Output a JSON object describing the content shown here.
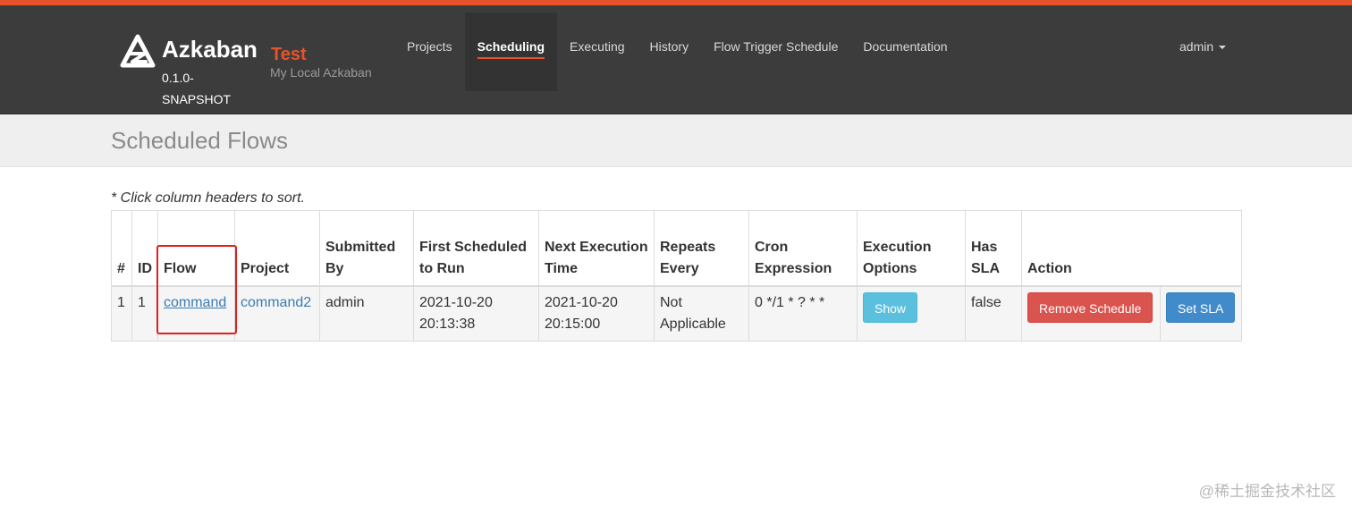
{
  "brand": {
    "name": "Azkaban",
    "version": "0.1.0-SNAPSHOT",
    "env_name": "Test",
    "env_description": "My Local Azkaban",
    "accent_color": "#e8532a"
  },
  "nav": {
    "items": [
      {
        "label": "Projects",
        "active": false
      },
      {
        "label": "Scheduling",
        "active": true
      },
      {
        "label": "Executing",
        "active": false
      },
      {
        "label": "History",
        "active": false
      },
      {
        "label": "Flow Trigger Schedule",
        "active": false
      },
      {
        "label": "Documentation",
        "active": false
      }
    ],
    "user": "admin"
  },
  "page": {
    "title": "Scheduled Flows",
    "hint": "* Click column headers to sort."
  },
  "table": {
    "headers": {
      "num": "#",
      "id": "ID",
      "flow": "Flow",
      "project": "Project",
      "submitted_by": "Submitted By",
      "first_scheduled": "First Scheduled to Run",
      "next_execution": "Next Execution Time",
      "repeats_every": "Repeats Every",
      "cron": "Cron Expression",
      "execution_options": "Execution Options",
      "has_sla": "Has SLA",
      "action": "Action"
    },
    "rows": [
      {
        "num": "1",
        "id": "1",
        "flow": "command",
        "project": "command2",
        "submitted_by": "admin",
        "first_scheduled": "2021-10-20 20:13:38",
        "next_execution": "2021-10-20 20:15:00",
        "repeats_every": "Not Applicable",
        "cron": "0 */1 * ? * *",
        "execution_options_label": "Show",
        "has_sla": "false",
        "remove_label": "Remove Schedule",
        "sla_label": "Set SLA"
      }
    ]
  },
  "watermark": "@稀土掘金技术社区"
}
